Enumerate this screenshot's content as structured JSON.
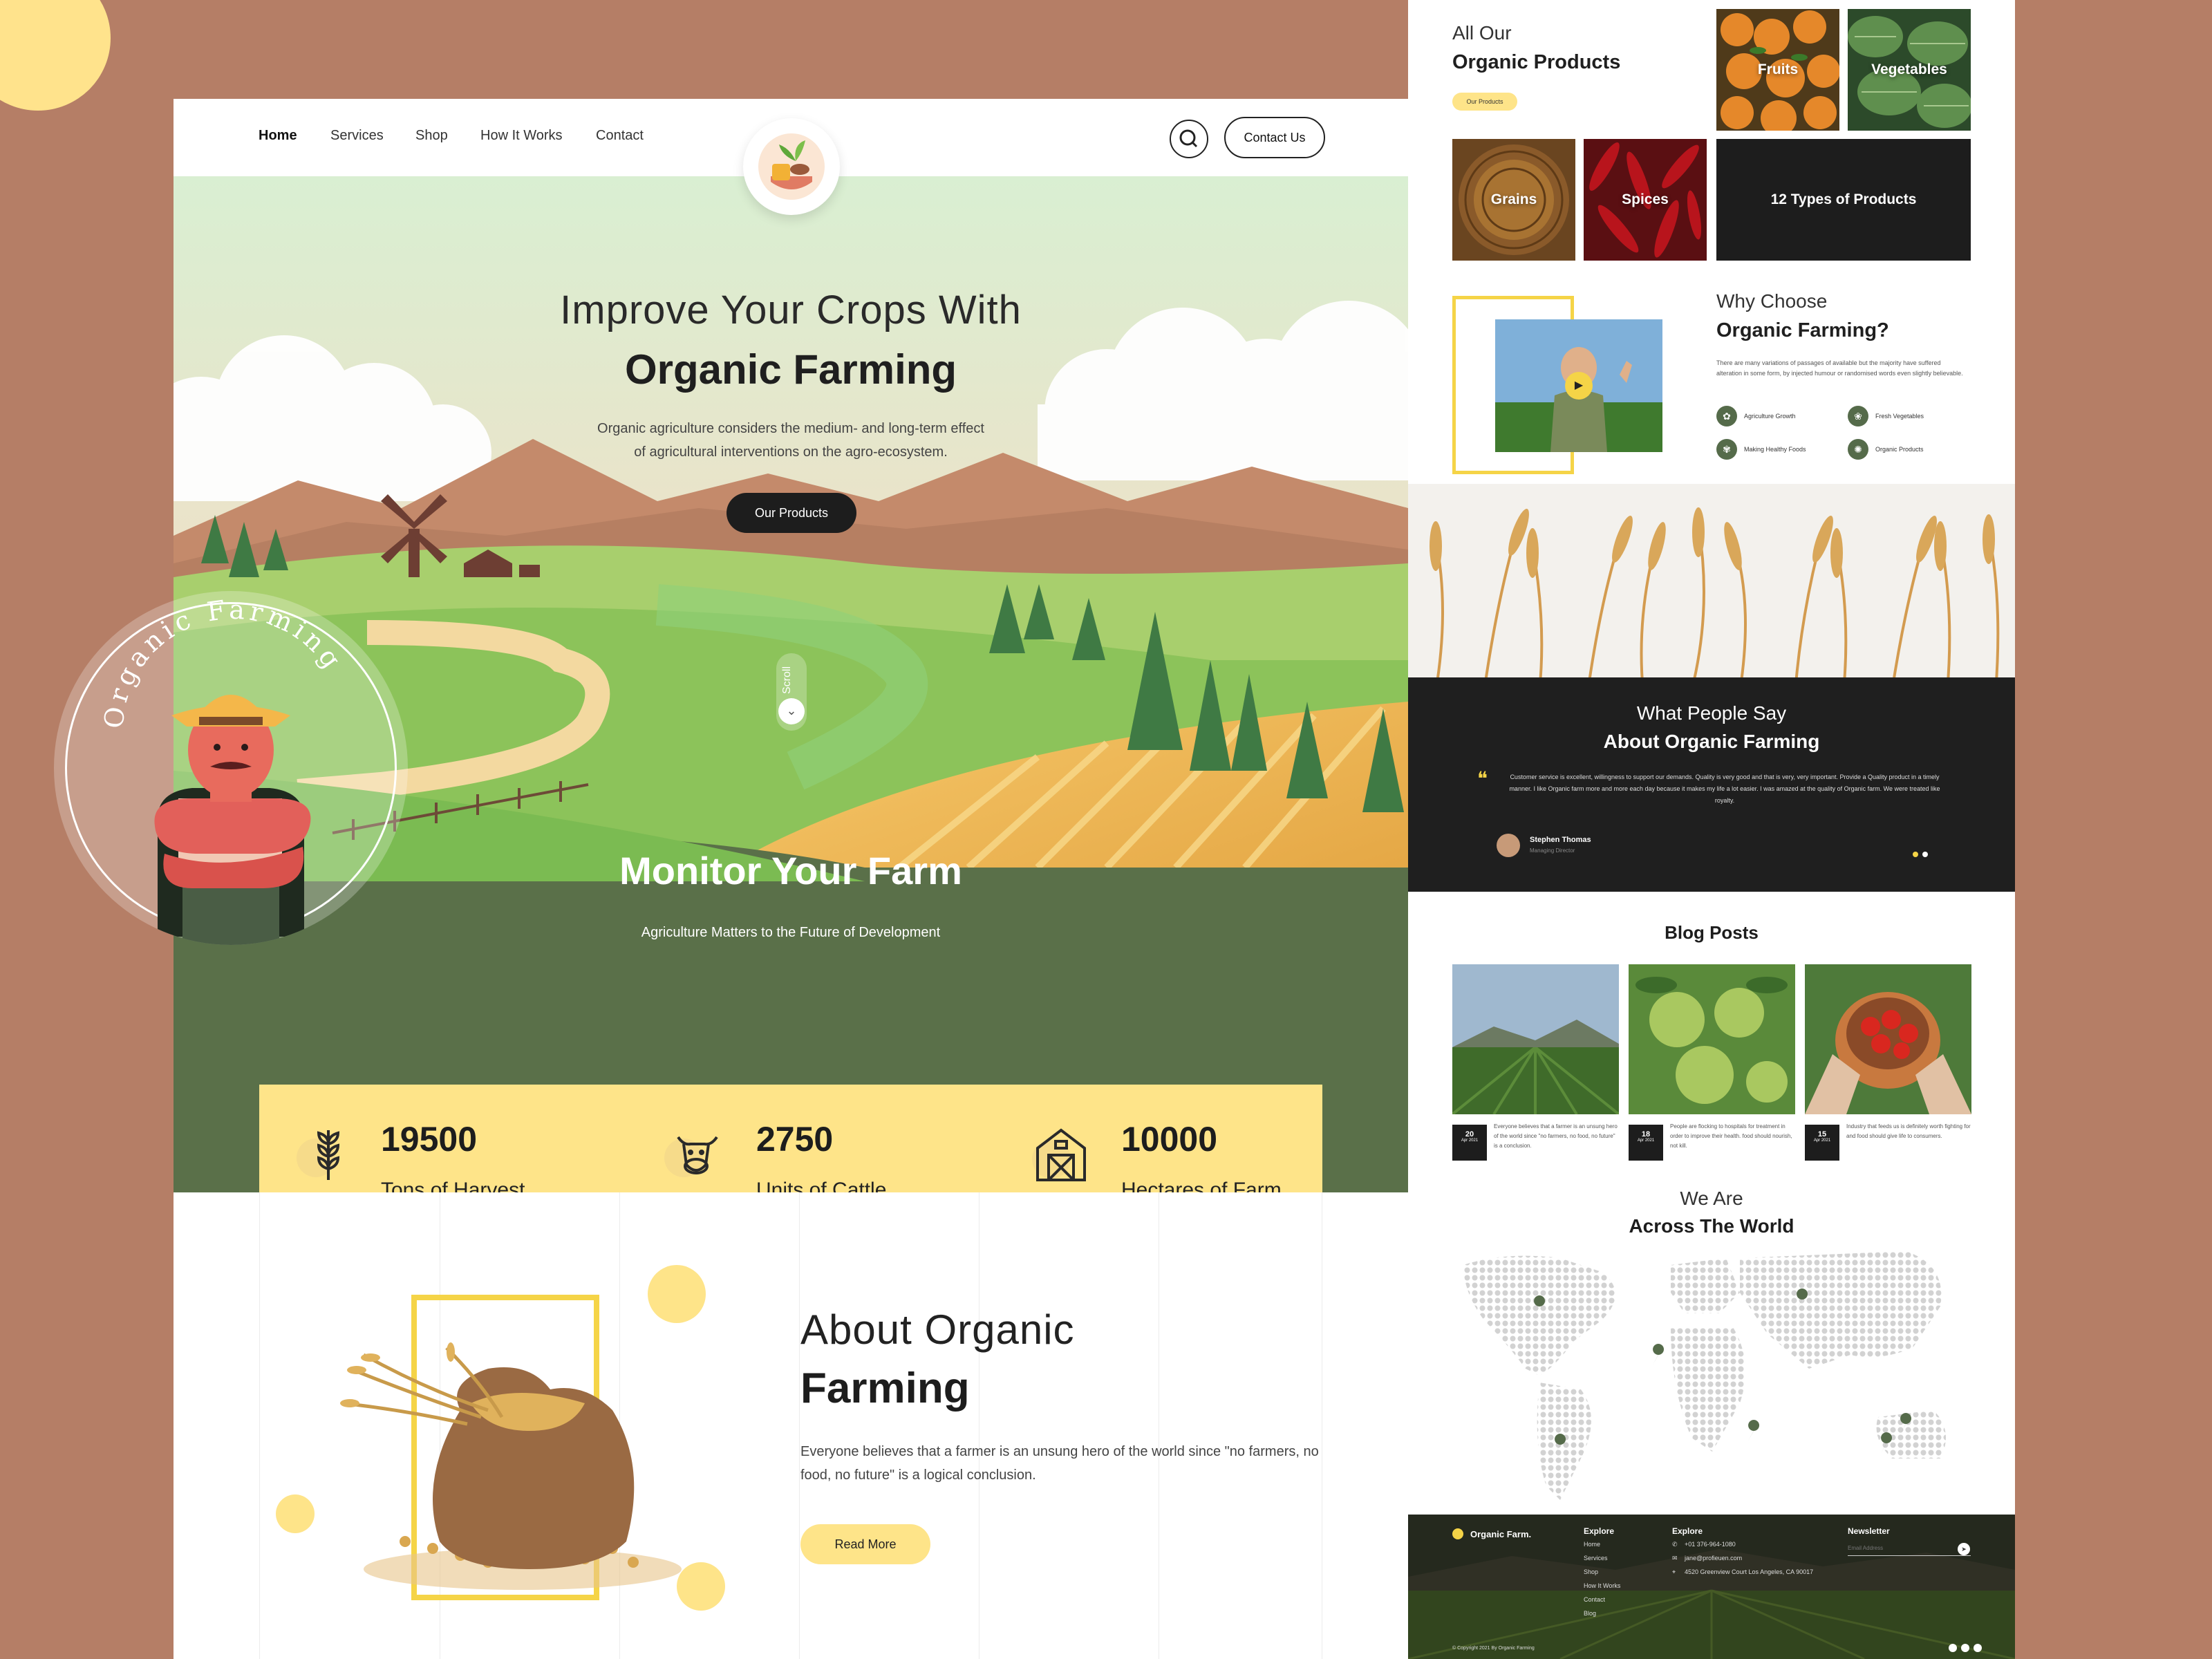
{
  "nav": {
    "items": [
      "Home",
      "Services",
      "Shop",
      "How It Works",
      "Contact"
    ],
    "contact_button": "Contact Us"
  },
  "hero": {
    "title_line1": "Improve Your Crops With",
    "title_line2": "Organic Farming",
    "description_line1": "Organic agriculture considers the medium- and long-term effect",
    "description_line2": "of agricultural interventions on the agro-ecosystem.",
    "cta": "Our Products",
    "scroll_label": "Scroll"
  },
  "badge": {
    "text": "Organic Farming"
  },
  "monitor": {
    "title": "Monitor Your Farm",
    "subtitle": "Agriculture Matters to the Future of Development",
    "stats": [
      {
        "value": "19500",
        "label": "Tons of Harvest",
        "icon": "wheat-icon"
      },
      {
        "value": "2750",
        "label": "Units of Cattle",
        "icon": "cow-icon"
      },
      {
        "value": "10000",
        "label": "Hectares of Farm",
        "icon": "barn-icon"
      }
    ]
  },
  "about": {
    "title_line1": "About Organic",
    "title_line2": "Farming",
    "description": "Everyone believes that a farmer is an unsung hero of the world since \"no farmers, no food, no future\" is a logical conclusion.",
    "cta": "Read More"
  },
  "products": {
    "title_line1": "All Our",
    "title_line2": "Organic Products",
    "pill": "Our Products",
    "tiles": [
      "Fruits",
      "Vegetables",
      "Grains",
      "Spices"
    ],
    "count_tile": "12 Types of Products"
  },
  "why": {
    "title_line1": "Why Choose",
    "title_line2": "Organic Farming?",
    "description": "There are many variations of passages of available but the majority have suffered alteration in some form, by injected humour or randomised words even slightly believable.",
    "features": [
      "Agriculture Growth",
      "Fresh Vegetables",
      "Making Healthy Foods",
      "Organic Products"
    ]
  },
  "testimonial": {
    "title_line1": "What People Say",
    "title_line2": "About Organic Farming",
    "quote": "Customer service is excellent, willingness to support our demands. Quality is very good and that is very, very important. Provide a Quality product in a timely manner. I like Organic farm more and more each day because it makes my life a lot easier. I was amazed at the quality of Organic farm. We were treated like royalty.",
    "author": "Stephen Thomas",
    "role": "Managing Director"
  },
  "blog": {
    "title": "Blog Posts",
    "posts": [
      {
        "day": "20",
        "month": "Apr 2021",
        "text": "Everyone believes that a farmer is an unsung hero of the world since \"no farmers, no food, no future\" is a conclusion."
      },
      {
        "day": "18",
        "month": "Apr 2021",
        "text": "People are flocking to hospitals for treatment in order to improve their health. food should nourish, not kill."
      },
      {
        "day": "15",
        "month": "Apr 2021",
        "text": "Industry that feeds us is definitely worth fighting for and food should give life to consumers."
      }
    ]
  },
  "world": {
    "title_line1": "We Are",
    "title_line2": "Across The World"
  },
  "footer": {
    "brand": "Organic Farm.",
    "explore_heading": "Explore",
    "explore_links": [
      "Home",
      "Services",
      "Shop",
      "How It Works",
      "Contact",
      "Blog"
    ],
    "contact_heading": "Explore",
    "phone": "+01 376-964-1080",
    "email": "jane@profieuen.com",
    "address": "4520 Greenview Court Los Angeles, CA 90017",
    "newsletter_heading": "Newsletter",
    "email_placeholder": "Email Address",
    "copyright": "© Copyright 2021 By Organic Farming"
  },
  "colors": {
    "background": "#b57e66",
    "accent_yellow": "#fee489",
    "farm_green": "#556b4a",
    "dark": "#1d1d1d"
  }
}
